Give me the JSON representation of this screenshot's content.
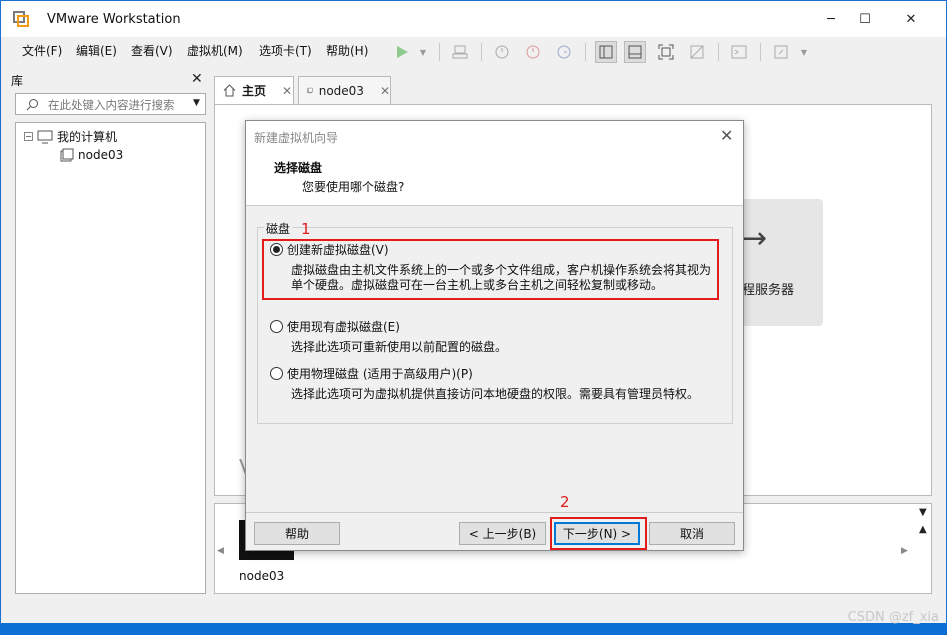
{
  "window": {
    "title": "VMware Workstation"
  },
  "menu": [
    "文件(F)",
    "编辑(E)",
    "查看(V)",
    "虚拟机(M)",
    "选项卡(T)",
    "帮助(H)"
  ],
  "library": {
    "header": "库",
    "search_placeholder": "在此处键入内容进行搜索",
    "tree": {
      "root": "我的计算机",
      "child": "node03"
    }
  },
  "tabs": [
    {
      "label": "主页"
    },
    {
      "label": "node03"
    }
  ],
  "home": {
    "remote_server_label": "程服务器",
    "partial_text": "V"
  },
  "thumbnail": {
    "label": "node03"
  },
  "dialog": {
    "title": "新建虚拟机向导",
    "heading": "选择磁盘",
    "subheading": "您要使用哪个磁盘?",
    "group_label": "磁盘",
    "options": [
      {
        "label": "创建新虚拟磁盘(V)",
        "selected": true,
        "description": "虚拟磁盘由主机文件系统上的一个或多个文件组成，客户机操作系统会将其视为单个硬盘。虚拟磁盘可在一台主机上或多台主机之间轻松复制或移动。"
      },
      {
        "label": "使用现有虚拟磁盘(E)",
        "selected": false,
        "description": "选择此选项可重新使用以前配置的磁盘。"
      },
      {
        "label": "使用物理磁盘 (适用于高级用户)(P)",
        "selected": false,
        "description": "选择此选项可为虚拟机提供直接访问本地硬盘的权限。需要具有管理员特权。"
      }
    ],
    "buttons": {
      "help": "帮助",
      "back": "< 上一步(B)",
      "next": "下一步(N) >",
      "cancel": "取消"
    }
  },
  "annotations": {
    "one": "1",
    "two": "2",
    "color": "#e21b1b"
  },
  "watermark": "CSDN @zf_xia",
  "colors": {
    "accent": "#0078d7",
    "desktop": "#0a6ed4"
  }
}
